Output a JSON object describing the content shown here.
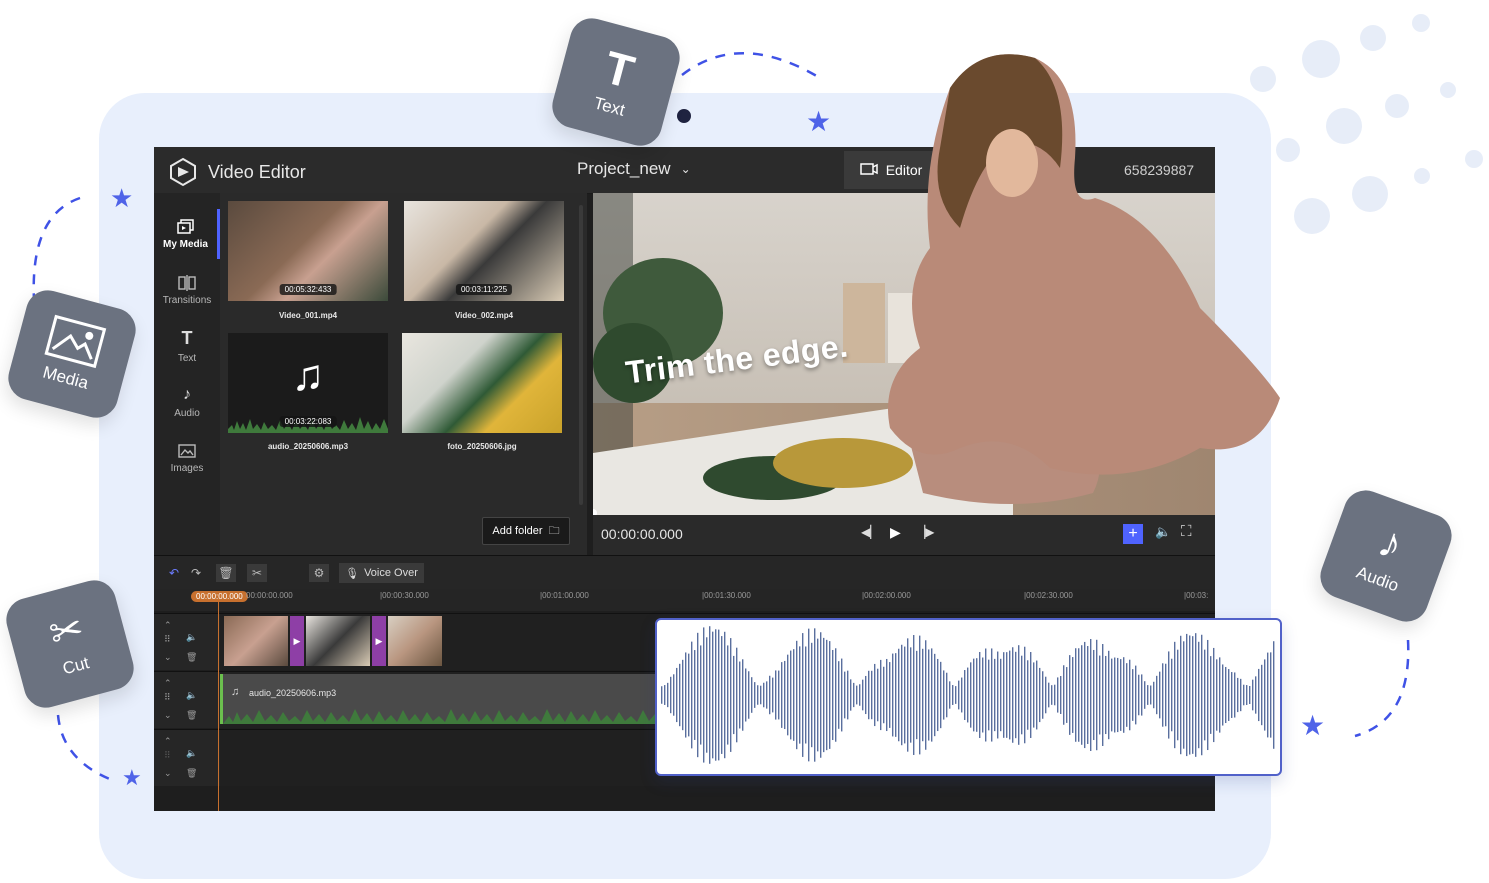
{
  "app": {
    "title": "Video Editor",
    "project_name": "Project_new",
    "mode_button": "Editor",
    "account_id": "658239887"
  },
  "nav": [
    {
      "label": "My Media",
      "icon": "my-media-icon",
      "active": true
    },
    {
      "label": "Transitions",
      "icon": "transitions-icon",
      "active": false
    },
    {
      "label": "Text",
      "icon": "text-icon",
      "active": false
    },
    {
      "label": "Audio",
      "icon": "audio-icon",
      "active": false
    },
    {
      "label": "Images",
      "icon": "images-icon",
      "active": false
    }
  ],
  "media": [
    {
      "name": "Video_001.mp4",
      "duration": "00:05:32:433",
      "type": "video"
    },
    {
      "name": "Video_002.mp4",
      "duration": "00:03:11:225",
      "type": "video"
    },
    {
      "name": "audio_20250606.mp3",
      "duration": "00:03:22:083",
      "type": "audio"
    },
    {
      "name": "foto_20250606.jpg",
      "duration": "",
      "type": "image"
    }
  ],
  "media_panel": {
    "add_folder": "Add folder"
  },
  "preview": {
    "overlay_text": "Trim the edge.",
    "timecode": "00:00:00.000"
  },
  "timeline": {
    "voice_over": "Voice Over",
    "playhead": "00:00:00.000",
    "ruler_labels": [
      "00:00:00.000",
      "|00:00:30.000",
      "|00:01:00.000",
      "|00:01:30.000",
      "|00:02:00.000",
      "|00:02:30.000",
      "|00:03:"
    ],
    "audio_clip": "audio_20250606.mp3"
  },
  "floating_badges": {
    "text": "Text",
    "media": "Media",
    "cut": "Cut",
    "audio": "Audio"
  },
  "colors": {
    "accent": "#4f63ff",
    "badge": "#6b7280",
    "stage": "#e8effc",
    "transition": "#8e3fa6"
  }
}
